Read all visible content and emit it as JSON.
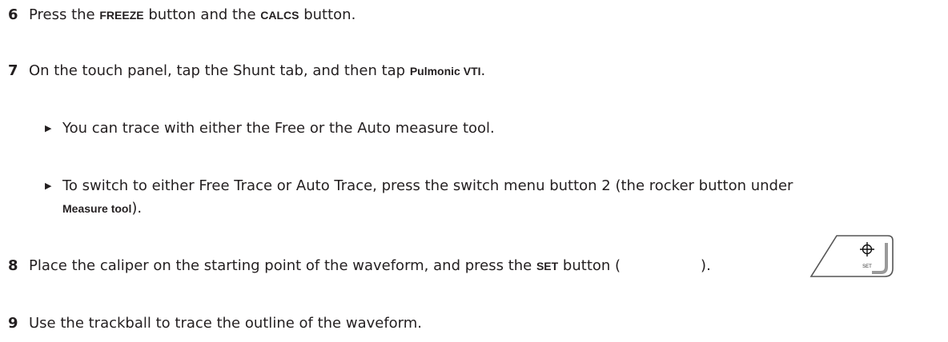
{
  "steps": [
    {
      "num": "6",
      "t1": "Press the ",
      "b1": "FREEZE",
      "t2": " button and the ",
      "b2": "CALCS",
      "t3": " button."
    },
    {
      "num": "7",
      "t1": "On the touch panel, tap the Shunt tab, and then tap ",
      "b1": "Pulmonic VTI",
      "t2": "."
    },
    {
      "num": "8",
      "t1": "Place the caliper on the starting point of the waveform, and press the ",
      "b1": "SET",
      "t2": " button (",
      "t3": ")."
    },
    {
      "num": "9",
      "t1": "Use the trackball to trace the outline of the waveform."
    }
  ],
  "bullets": [
    {
      "text": "You can trace with either the Free or the Auto measure tool."
    },
    {
      "text": "To switch to either Free Trace or Auto Trace, press the switch menu button 2 (the rocker button under",
      "b": "Measure tool",
      "t2": ")."
    }
  ],
  "set_button": {
    "label": "SET",
    "icon": "crosshair-icon"
  }
}
